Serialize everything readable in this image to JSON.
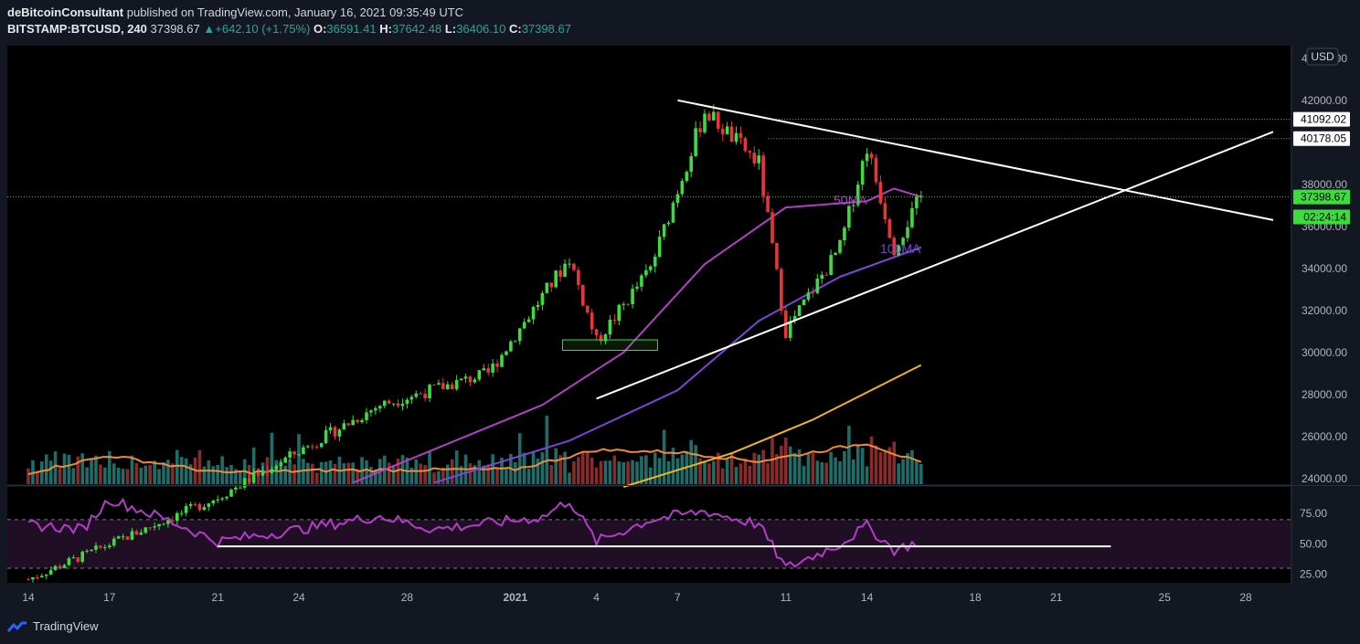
{
  "header": {
    "publisher": "deBitcoinConsultant",
    "published_text": "published on TradingView.com, January 16, 2021 09:35:49 UTC",
    "symbol": "BITSTAMP:BTCUSD, 240",
    "last": "37398.67",
    "change": "+642.10 (+1.75%)",
    "o_label": "O:",
    "o": "36591.41",
    "h_label": "H:",
    "h": "37642.48",
    "l_label": "L:",
    "l": "36406.10",
    "c_label": "C:",
    "c": "37398.67"
  },
  "footer": {
    "brand": "TradingView"
  },
  "colors": {
    "background": "#000000",
    "up": "#3ddc3d",
    "down": "#e8353a",
    "vol_up": "#1d6e6a",
    "vol_down": "#8a2b2b",
    "ma50": "#b23fc4",
    "ma100": "#7d45d8",
    "ma200": "#f5b31b",
    "vol_ma": "#f08a3a",
    "rsi": "#b43cc8",
    "trend": "#ffffff"
  },
  "chart_data": {
    "type": "candlestick",
    "currency_label": "USD",
    "price_axis": {
      "ticks": [
        "24000.00",
        "26000.00",
        "28000.00",
        "30000.00",
        "32000.00",
        "34000.00",
        "36000.00",
        "38000.00",
        "42000.00",
        "44000.00"
      ],
      "tick_values": [
        24000,
        26000,
        28000,
        30000,
        32000,
        34000,
        36000,
        38000,
        42000,
        44000
      ],
      "range": [
        23600,
        44600
      ]
    },
    "price_tags": [
      {
        "label": "41092.02",
        "value": 41092.02,
        "style": "white"
      },
      {
        "label": "40178.05",
        "value": 40178.05,
        "style": "white"
      },
      {
        "label": "37398.67",
        "value": 37398.67,
        "style": "green"
      },
      {
        "label": "02:24:14",
        "value": 36450,
        "style": "green"
      }
    ],
    "date_axis": {
      "labels": [
        "14",
        "17",
        "21",
        "24",
        "28",
        "2021",
        "4",
        "7",
        "11",
        "14",
        "18",
        "21",
        "25",
        "28"
      ],
      "dates": [
        "2020-12-14",
        "2020-12-17",
        "2020-12-21",
        "2020-12-24",
        "2020-12-28",
        "2021-01-01",
        "2021-01-04",
        "2021-01-07",
        "2021-01-11",
        "2021-01-14",
        "2021-01-18",
        "2021-01-21",
        "2021-01-25",
        "2021-01-28"
      ]
    },
    "annotations": [
      {
        "text": "50MA",
        "color": "#b23fc4"
      },
      {
        "text": "100MA",
        "color": "#7d45d8"
      }
    ],
    "key_points": [
      {
        "date": "2020-12-14",
        "price": 19200
      },
      {
        "date": "2020-12-21",
        "price": 23100
      },
      {
        "date": "2020-12-27",
        "price": 27500
      },
      {
        "date": "2020-12-31",
        "price": 29000
      },
      {
        "date": "2021-01-03",
        "price": 34500
      },
      {
        "date": "2021-01-04",
        "price": 30500
      },
      {
        "date": "2021-01-06",
        "price": 34000
      },
      {
        "date": "2021-01-08",
        "price": 41500
      },
      {
        "date": "2021-01-10",
        "price": 39000
      },
      {
        "date": "2021-01-11",
        "price": 31000
      },
      {
        "date": "2021-01-13",
        "price": 35000
      },
      {
        "date": "2021-01-14",
        "price": 39800
      },
      {
        "date": "2021-01-15",
        "price": 35000
      },
      {
        "date": "2021-01-16",
        "price": 37398.67
      }
    ],
    "ma_lines": {
      "ma50": [
        {
          "date": "2020-12-26",
          "price": 23800
        },
        {
          "date": "2021-01-02",
          "price": 27500
        },
        {
          "date": "2021-01-05",
          "price": 30000
        },
        {
          "date": "2021-01-08",
          "price": 34200
        },
        {
          "date": "2021-01-11",
          "price": 36900
        },
        {
          "date": "2021-01-14",
          "price": 37200
        },
        {
          "date": "2021-01-15",
          "price": 37800
        },
        {
          "date": "2021-01-16",
          "price": 37400
        }
      ],
      "ma100": [
        {
          "date": "2020-12-29",
          "price": 23800
        },
        {
          "date": "2021-01-03",
          "price": 25800
        },
        {
          "date": "2021-01-07",
          "price": 28200
        },
        {
          "date": "2021-01-10",
          "price": 31500
        },
        {
          "date": "2021-01-13",
          "price": 33600
        },
        {
          "date": "2021-01-16",
          "price": 35000
        }
      ],
      "ma200": [
        {
          "date": "2021-01-05",
          "price": 23600
        },
        {
          "date": "2021-01-09",
          "price": 25200
        },
        {
          "date": "2021-01-12",
          "price": 26800
        },
        {
          "date": "2021-01-16",
          "price": 29400
        }
      ]
    },
    "trendlines": [
      {
        "from": {
          "date": "2021-01-07",
          "price": 42000
        },
        "to": {
          "date": "2021-01-28",
          "price": 36300
        }
      },
      {
        "from": {
          "date": "2021-01-04",
          "price": 27800
        },
        "to": {
          "date": "2021-01-28",
          "price": 40500
        }
      }
    ],
    "rsi": {
      "ticks": [
        "75.00",
        "50.00",
        "25.00"
      ],
      "tick_values": [
        75,
        50,
        25
      ],
      "band": [
        30,
        70
      ],
      "range": [
        18,
        97
      ],
      "key_points": [
        {
          "date": "2020-12-14",
          "value": 66
        },
        {
          "date": "2020-12-16",
          "value": 62
        },
        {
          "date": "2020-12-17",
          "value": 87
        },
        {
          "date": "2020-12-19",
          "value": 71
        },
        {
          "date": "2020-12-21",
          "value": 52
        },
        {
          "date": "2020-12-24",
          "value": 62
        },
        {
          "date": "2020-12-27",
          "value": 73
        },
        {
          "date": "2020-12-29",
          "value": 62
        },
        {
          "date": "2021-01-02",
          "value": 72
        },
        {
          "date": "2021-01-03",
          "value": 86
        },
        {
          "date": "2021-01-04",
          "value": 52
        },
        {
          "date": "2021-01-06",
          "value": 70
        },
        {
          "date": "2021-01-08",
          "value": 77
        },
        {
          "date": "2021-01-10",
          "value": 66
        },
        {
          "date": "2021-01-11",
          "value": 30
        },
        {
          "date": "2021-01-13",
          "value": 50
        },
        {
          "date": "2021-01-14",
          "value": 65
        },
        {
          "date": "2021-01-15",
          "value": 45
        },
        {
          "date": "2021-01-16",
          "value": 52
        }
      ],
      "support_line": {
        "from": "2020-12-21",
        "to": "2021-01-22",
        "value": 48
      }
    },
    "volume_ma": [
      {
        "date": "2020-12-14",
        "value": 0.1
      },
      {
        "date": "2020-12-17",
        "value": 0.25
      },
      {
        "date": "2020-12-21",
        "value": 0.1
      },
      {
        "date": "2020-12-25",
        "value": 0.12
      },
      {
        "date": "2021-01-01",
        "value": 0.13
      },
      {
        "date": "2021-01-04",
        "value": 0.3
      },
      {
        "date": "2021-01-07",
        "value": 0.28
      },
      {
        "date": "2021-01-10",
        "value": 0.2
      },
      {
        "date": "2021-01-14",
        "value": 0.36
      },
      {
        "date": "2021-01-16",
        "value": 0.18
      }
    ]
  }
}
